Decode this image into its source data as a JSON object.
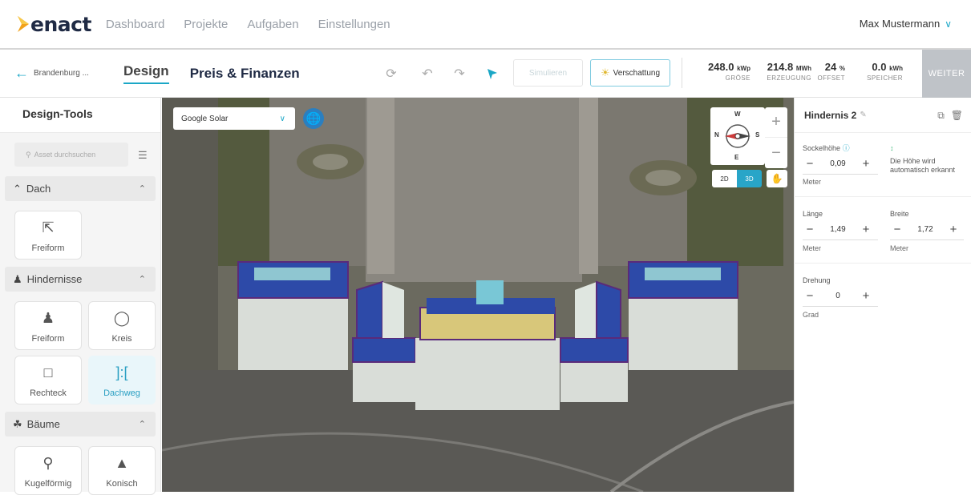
{
  "nav": {
    "logo": "enact",
    "links": [
      "Dashboard",
      "Projekte",
      "Aufgaben",
      "Einstellungen"
    ],
    "user": "Max Mustermann"
  },
  "toolbar": {
    "back_label": "Brandenburg ...",
    "tabs": [
      "Design",
      "Preis & Finanzen"
    ],
    "simulate": "Simulieren",
    "shading": "Verschattung",
    "stats": [
      {
        "value": "248.0",
        "unit": "kWp",
        "label": "GRÖSE"
      },
      {
        "value": "214.8",
        "unit": "MWh",
        "label": "ERZEUGUNG"
      },
      {
        "value": "24",
        "unit": "%",
        "label": "OFFSET"
      },
      {
        "value": "0.0",
        "unit": "kWh",
        "label": "SPEICHER"
      }
    ],
    "next": "WEITER"
  },
  "sidebar": {
    "title": "Design-Tools",
    "search_placeholder": "Asset durchsuchen",
    "sections": {
      "dach": {
        "label": "Dach",
        "items": [
          "Freiform"
        ]
      },
      "hindernisse": {
        "label": "Hindernisse",
        "items": [
          "Freiform",
          "Kreis",
          "Rechteck",
          "Dachweg"
        ]
      },
      "baeume": {
        "label": "Bäume",
        "items": [
          "Kugelförmig",
          "Konisch"
        ]
      }
    }
  },
  "map": {
    "layer": "Google Solar",
    "view_2d": "2D",
    "view_3d": "3D",
    "compass": {
      "n": "N",
      "w": "W",
      "e": "E",
      "s": "S"
    }
  },
  "panel": {
    "title": "Hindernis 2",
    "sockel": {
      "label": "Sockelhöhe",
      "value": "0,09",
      "unit": "Meter"
    },
    "hint": "Die Höhe wird automatisch erkannt",
    "laenge": {
      "label": "Länge",
      "value": "1,49",
      "unit": "Meter"
    },
    "breite": {
      "label": "Breite",
      "value": "1,72",
      "unit": "Meter"
    },
    "drehung": {
      "label": "Drehung",
      "value": "0",
      "unit": "Grad"
    }
  }
}
